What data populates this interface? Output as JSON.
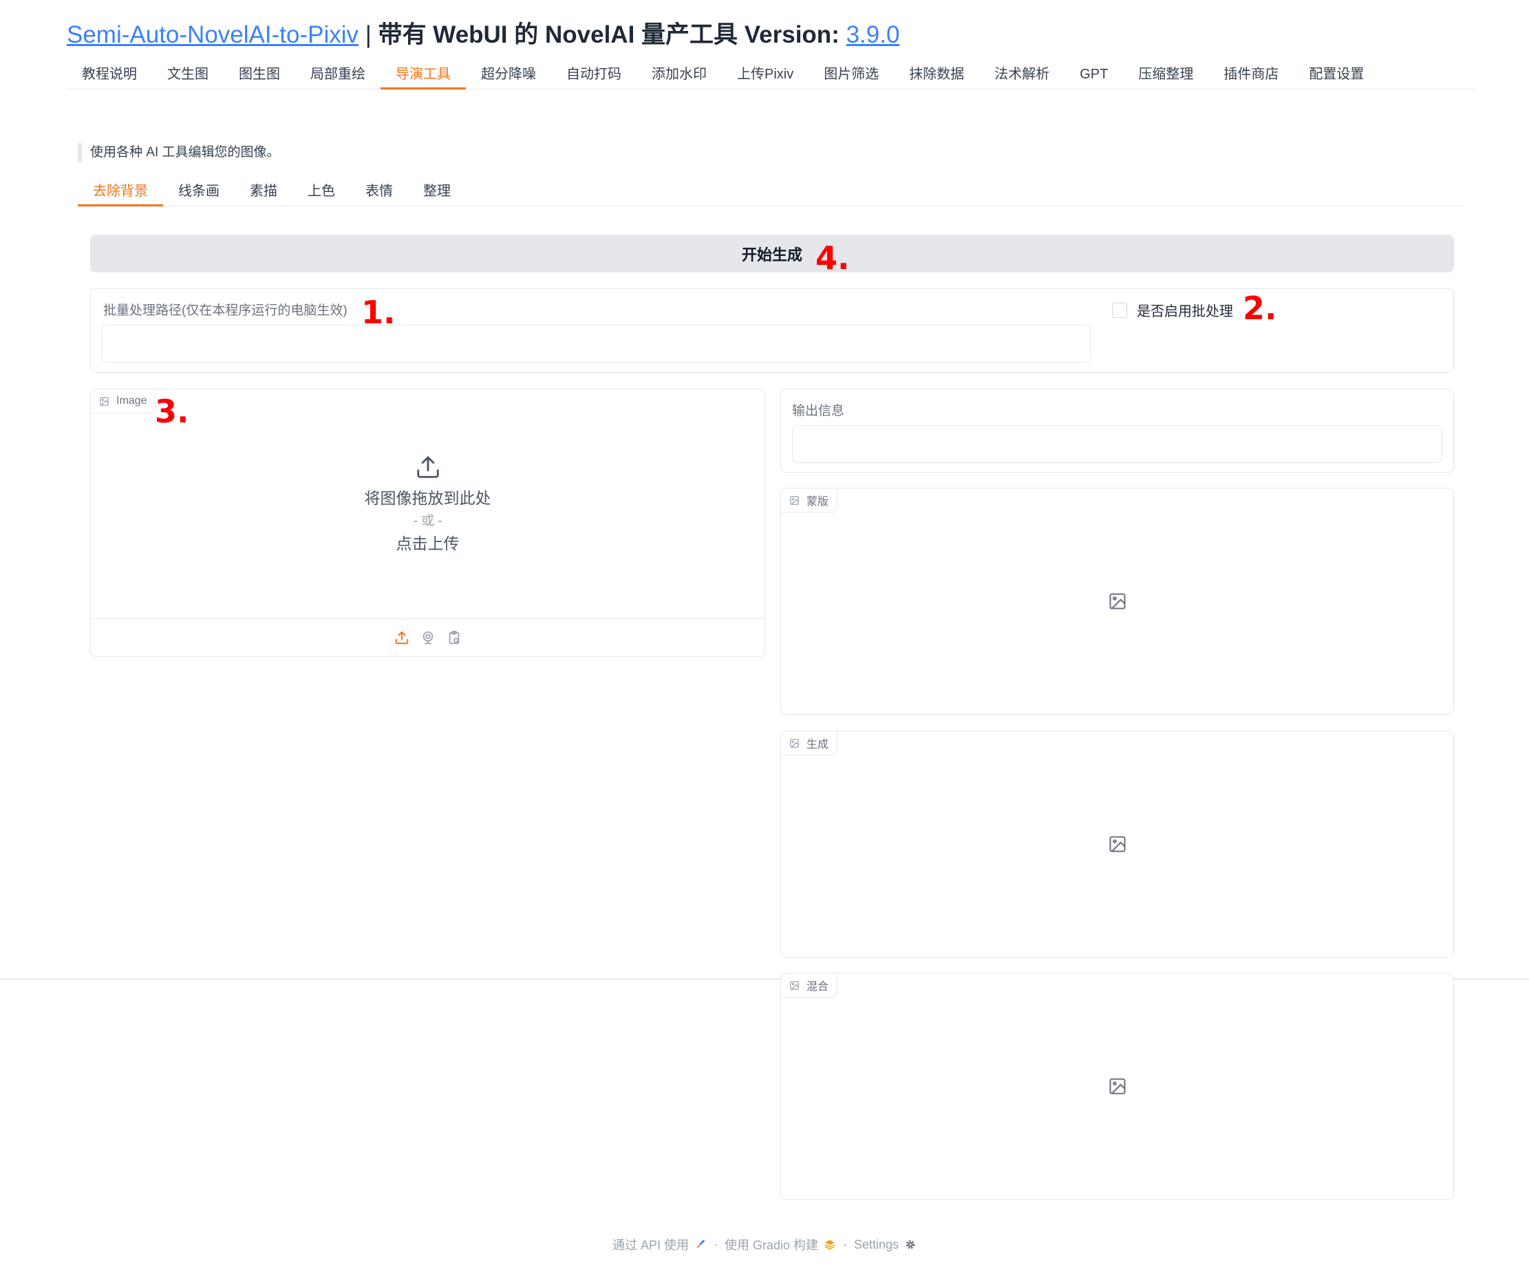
{
  "header": {
    "link_text": "Semi-Auto-NovelAI-to-Pixiv",
    "separator": "|",
    "subtitle": "带有 WebUI 的 NovelAI 量产工具 Version:",
    "version": "3.9.0"
  },
  "main_tabs": [
    {
      "label": "教程说明"
    },
    {
      "label": "文生图"
    },
    {
      "label": "图生图"
    },
    {
      "label": "局部重绘"
    },
    {
      "label": "导演工具",
      "active": true
    },
    {
      "label": "超分降噪"
    },
    {
      "label": "自动打码"
    },
    {
      "label": "添加水印"
    },
    {
      "label": "上传Pixiv"
    },
    {
      "label": "图片筛选"
    },
    {
      "label": "抹除数据"
    },
    {
      "label": "法术解析"
    },
    {
      "label": "GPT"
    },
    {
      "label": "压缩整理"
    },
    {
      "label": "插件商店"
    },
    {
      "label": "配置设置"
    }
  ],
  "description": "使用各种 AI 工具编辑您的图像。",
  "sub_tabs": [
    {
      "label": "去除背景",
      "active": true
    },
    {
      "label": "线条画"
    },
    {
      "label": "素描"
    },
    {
      "label": "上色"
    },
    {
      "label": "表情"
    },
    {
      "label": "整理"
    }
  ],
  "generate_button": {
    "label": "开始生成"
  },
  "batch": {
    "path_label": "批量处理路径(仅在本程序运行的电脑生效)",
    "path_value": "",
    "enable_label": "是否启用批处理",
    "enabled": false
  },
  "image_input": {
    "label": "Image",
    "drop_text": "将图像拖放到此处",
    "or_text": "- 或 -",
    "click_text": "点击上传"
  },
  "output_info": {
    "label": "输出信息",
    "value": ""
  },
  "image_outputs": [
    {
      "label": "蒙版"
    },
    {
      "label": "生成"
    },
    {
      "label": "混合"
    }
  ],
  "annotations": {
    "m1": "1.",
    "m2": "2.",
    "m3": "3.",
    "m4": "4."
  },
  "footer": {
    "api": "通过 API 使用",
    "gradio": "使用 Gradio 构建",
    "settings": "Settings",
    "dot": "·"
  },
  "colors": {
    "accent": "#f97316",
    "link": "#3b82f6",
    "annotation": "#ff0000",
    "border": "#e5e7eb",
    "button_bg": "#e5e7eb"
  }
}
